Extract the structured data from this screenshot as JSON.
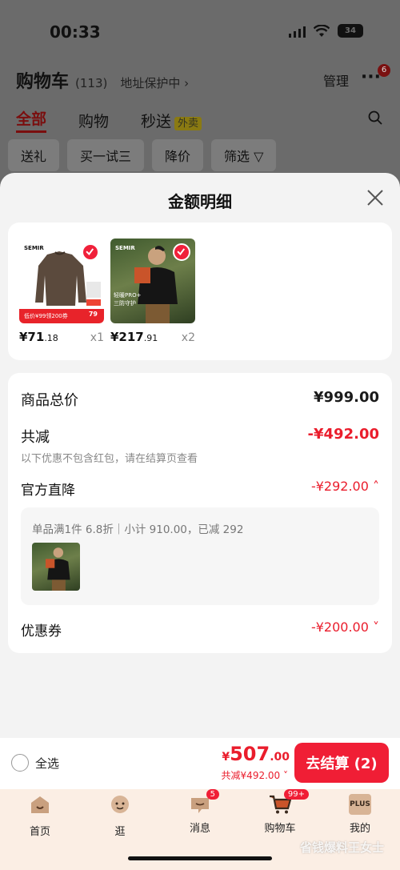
{
  "status_bar": {
    "time": "00:33",
    "battery": "34"
  },
  "background": {
    "title": "购物车",
    "count": "(113)",
    "address": "地址保护中 ›",
    "manage": "管理",
    "more": "···",
    "more_badge": "6",
    "tabs": [
      {
        "label": "全部",
        "active": true
      },
      {
        "label": "购物"
      },
      {
        "label": "秒送",
        "badge": "外卖"
      }
    ],
    "filters": [
      "送礼",
      "买一试三",
      "降价",
      "筛选 ▽"
    ]
  },
  "sheet": {
    "title": "金额明细",
    "products": [
      {
        "price_int": "¥71",
        "price_dec": ".18",
        "qty": "x1",
        "image_name": "brown-sweater-product-image",
        "brand": "SEMIR",
        "promo": "低价¥99领200券",
        "price_tag": "79"
      },
      {
        "price_int": "¥217",
        "price_dec": ".91",
        "qty": "x2",
        "image_name": "black-jacket-product-image",
        "brand": "SEMIR",
        "promo": "轻暖PRO+\n三防守护"
      }
    ],
    "summary": {
      "total_label": "商品总价",
      "total_value": "¥999.00",
      "reduce_label": "共减",
      "reduce_value": "-¥492.00",
      "reduce_note": "以下优惠不包含红包，请在结算页查看",
      "official_label": "官方直降",
      "official_value": "-¥292.00 ˄",
      "discount_detail": "单品满1件 6.8折｜小计 910.00，已减 292",
      "coupon_label": "优惠券",
      "coupon_value": "-¥200.00 ˅"
    }
  },
  "bottom_bar": {
    "select_all": "全选",
    "yen": "¥",
    "total_int": "507",
    "total_dec": ".00",
    "saved": "共减¥492.00 ˅",
    "checkout": "去结算 (2)"
  },
  "tab_bar": [
    {
      "label": "首页",
      "icon": "home-icon"
    },
    {
      "label": "逛",
      "icon": "face-icon"
    },
    {
      "label": "消息",
      "icon": "message-icon",
      "badge": "5"
    },
    {
      "label": "购物车",
      "icon": "cart-icon",
      "badge": "99+"
    },
    {
      "label": "我的",
      "icon": "plus-member-icon",
      "icon_text": "PLUS"
    }
  ],
  "watermark": "省钱爆料王女士",
  "colors": {
    "accent": "#f01e35",
    "price_red": "#ea1d2c"
  }
}
